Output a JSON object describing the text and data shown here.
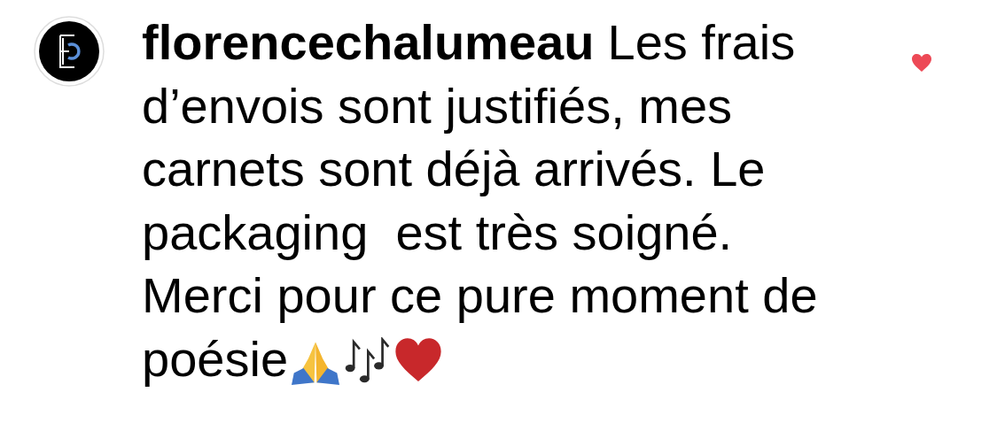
{
  "comment": {
    "username": "florencechalumeau",
    "lines": [
      "Les frais",
      "d’envois sont justifiés, mes",
      "carnets sont déjà arrivés. Le",
      "packaging  est très soigné.",
      "Merci pour ce pure moment de",
      "poésie"
    ],
    "liked": true
  }
}
